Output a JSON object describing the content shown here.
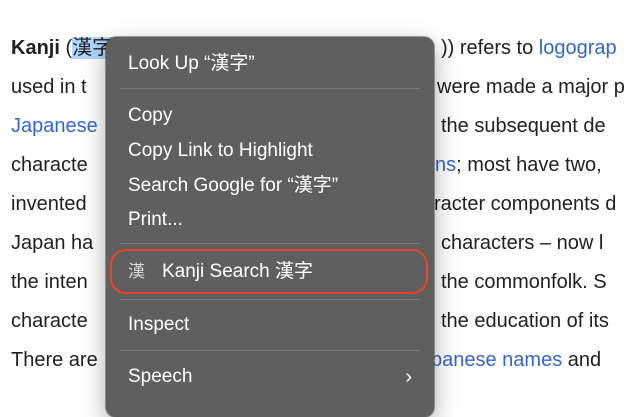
{
  "article": {
    "lines": [
      {
        "pre_bold": "Kanji",
        "pre": " (",
        "selected": "漢字",
        "mid": "",
        "post": ")) refers to ",
        "link": "logograp"
      },
      {
        "pre": "used in t",
        "post": "were made a major p"
      },
      {
        "link_pre": "Japanese",
        "post": "the subsequent de"
      },
      {
        "pre": "characte",
        "link_mid": "ns",
        "post": "; most have two,"
      },
      {
        "pre": "invented",
        "post": "racter components d"
      },
      {
        "pre": "Japan ha",
        "post": "characters – now l"
      },
      {
        "pre": "the inten",
        "post": "the commonfolk. S"
      },
      {
        "pre": "characte",
        "post": "the education of its"
      },
      {
        "pre": "There are",
        "link": "panese names",
        "post": " and"
      }
    ]
  },
  "context_menu": {
    "look_up": "Look Up “漢字”",
    "copy": "Copy",
    "copy_link_highlight": "Copy Link to Highlight",
    "search_google": "Search Google for “漢字”",
    "print": "Print...",
    "extension_icon_glyph": "漢",
    "extension_label": "Kanji Search 漢字",
    "inspect": "Inspect",
    "speech": "Speech",
    "speech_chevron": "›"
  },
  "colors": {
    "menu_bg": "#5f5f5f",
    "highlight_ring": "#e8452a",
    "link": "#3366cc",
    "selection": "#b3d4fc"
  }
}
